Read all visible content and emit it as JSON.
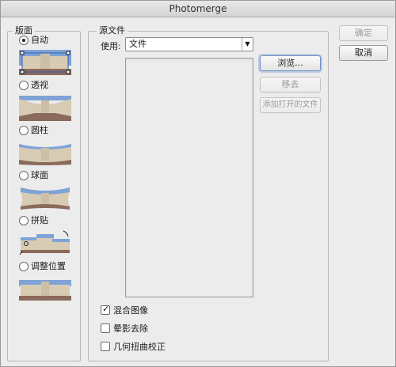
{
  "window": {
    "title": "Photomerge"
  },
  "layout": {
    "title": "版面",
    "options": [
      {
        "label": "自动",
        "selected": true,
        "icon": "auto-layout-thumbnail"
      },
      {
        "label": "透视",
        "selected": false,
        "icon": "perspective-thumbnail"
      },
      {
        "label": "圆柱",
        "selected": false,
        "icon": "cylindrical-thumbnail"
      },
      {
        "label": "球面",
        "selected": false,
        "icon": "spherical-thumbnail"
      },
      {
        "label": "拼贴",
        "selected": false,
        "icon": "collage-thumbnail"
      },
      {
        "label": "调整位置",
        "selected": false,
        "icon": "reposition-thumbnail"
      }
    ]
  },
  "source": {
    "title": "源文件",
    "use_label": "使用:",
    "use_value": "文件",
    "browse_label": "浏览...",
    "remove_label": "移去",
    "add_open_label": "添加打开的文件",
    "options": {
      "blend": {
        "label": "混合图像",
        "checked": true
      },
      "vignette": {
        "label": "晕影去除",
        "checked": false
      },
      "distortion": {
        "label": "几何扭曲校正",
        "checked": false
      }
    }
  },
  "actions": {
    "ok_label": "确定",
    "cancel_label": "取消"
  },
  "colors": {
    "sky": "#7fa3d6",
    "building": "#d8cbb4",
    "ground": "#8a6a5c",
    "focus": "#6b8fc4"
  }
}
